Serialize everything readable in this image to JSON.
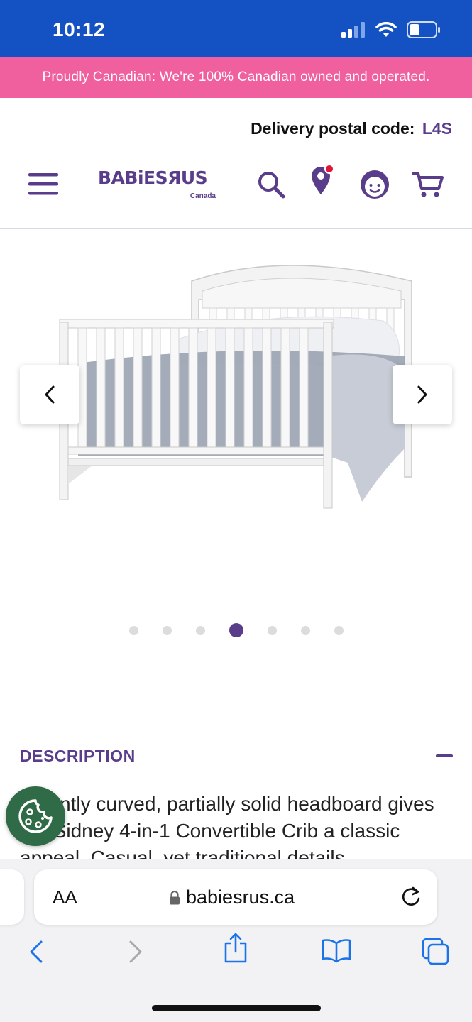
{
  "status_bar": {
    "time": "10:12"
  },
  "promo": {
    "text": "Proudly Canadian: We're 100% Canadian owned and operated."
  },
  "delivery": {
    "label": "Delivery postal code:",
    "code": "L4S"
  },
  "nav": {
    "logo_text": "BABiESЯUS",
    "logo_sub": "Canada",
    "icons": [
      "menu-icon",
      "search-icon",
      "location-pin-icon",
      "account-icon",
      "cart-icon"
    ]
  },
  "gallery": {
    "dot_count": 7,
    "active_index": 3
  },
  "description": {
    "heading": "DESCRIPTION",
    "body": "A gently curved, partially solid headboard gives the Sidney 4-in-1 Convertible Crib a classic appeal. Casual, yet traditional details"
  },
  "browser": {
    "aa_label": "AA",
    "url": "babiesrus.ca"
  },
  "colors": {
    "status_bar": "#1452c4",
    "promo": "#f0609e",
    "brand_purple": "#5a3d8a",
    "cookie_green": "#2f6b46",
    "safari_blue": "#1a73e8"
  }
}
